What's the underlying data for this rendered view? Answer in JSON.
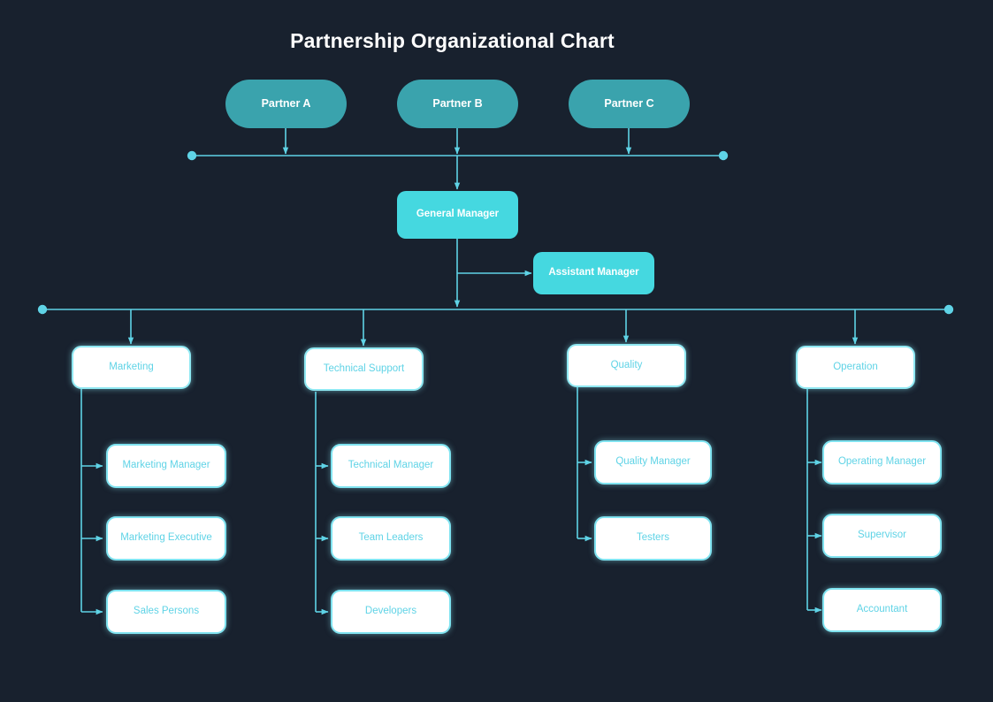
{
  "page": {
    "title": "Partnership Organizational Chart",
    "background_color": "#18212e",
    "connector_color": "#5fd3e6"
  },
  "chart_data": {
    "type": "diagram",
    "diagram_type": "organizational-chart",
    "title": "Partnership Organizational Chart",
    "levels": [
      {
        "level": 1,
        "style": "pill-teal",
        "nodes": [
          "Partner A",
          "Partner B",
          "Partner C"
        ]
      },
      {
        "level": 2,
        "style": "rounded-cyan",
        "nodes": [
          "General Manager",
          "Assistant Manager"
        ]
      },
      {
        "level": 3,
        "style": "white-card",
        "nodes": [
          "Marketing",
          "Technical Support",
          "Quality",
          "Operation"
        ]
      },
      {
        "level": 4,
        "style": "white-card",
        "nodes": [
          "Marketing Manager",
          "Marketing Executive",
          "Sales Persons",
          "Technical Manager",
          "Team Leaders",
          "Developers",
          "Quality Manager",
          "Testers",
          "Operating Manager",
          "Supervisor",
          "Accountant"
        ]
      }
    ],
    "edges": [
      {
        "from": "Partner A",
        "to": "partner-bus"
      },
      {
        "from": "Partner B",
        "to": "partner-bus"
      },
      {
        "from": "Partner C",
        "to": "partner-bus"
      },
      {
        "from": "partner-bus",
        "to": "General Manager"
      },
      {
        "from": "General Manager",
        "to": "Assistant Manager"
      },
      {
        "from": "General Manager",
        "to": "department-bus"
      },
      {
        "from": "department-bus",
        "to": "Marketing"
      },
      {
        "from": "department-bus",
        "to": "Technical Support"
      },
      {
        "from": "department-bus",
        "to": "Quality"
      },
      {
        "from": "department-bus",
        "to": "Operation"
      },
      {
        "from": "Marketing",
        "to": "Marketing Manager"
      },
      {
        "from": "Marketing",
        "to": "Marketing Executive"
      },
      {
        "from": "Marketing",
        "to": "Sales Persons"
      },
      {
        "from": "Technical Support",
        "to": "Technical Manager"
      },
      {
        "from": "Technical Support",
        "to": "Team Leaders"
      },
      {
        "from": "Technical Support",
        "to": "Developers"
      },
      {
        "from": "Quality",
        "to": "Quality Manager"
      },
      {
        "from": "Quality",
        "to": "Testers"
      },
      {
        "from": "Operation",
        "to": "Operating Manager"
      },
      {
        "from": "Operation",
        "to": "Supervisor"
      },
      {
        "from": "Operation",
        "to": "Accountant"
      }
    ]
  },
  "partners": {
    "a": "Partner A",
    "b": "Partner B",
    "c": "Partner C"
  },
  "managers": {
    "general": "General Manager",
    "assistant": "Assistant Manager"
  },
  "departments": {
    "marketing": "Marketing",
    "technical": "Technical Support",
    "quality": "Quality",
    "operation": "Operation"
  },
  "marketing_children": {
    "one": "Marketing Manager",
    "two": "Marketing Executive",
    "three": "Sales Persons"
  },
  "technical_children": {
    "one": "Technical Manager",
    "two": "Team Leaders",
    "three": "Developers"
  },
  "quality_children": {
    "one": "Quality Manager",
    "two": "Testers"
  },
  "operation_children": {
    "one": "Operating Manager",
    "two": "Supervisor",
    "three": "Accountant"
  }
}
